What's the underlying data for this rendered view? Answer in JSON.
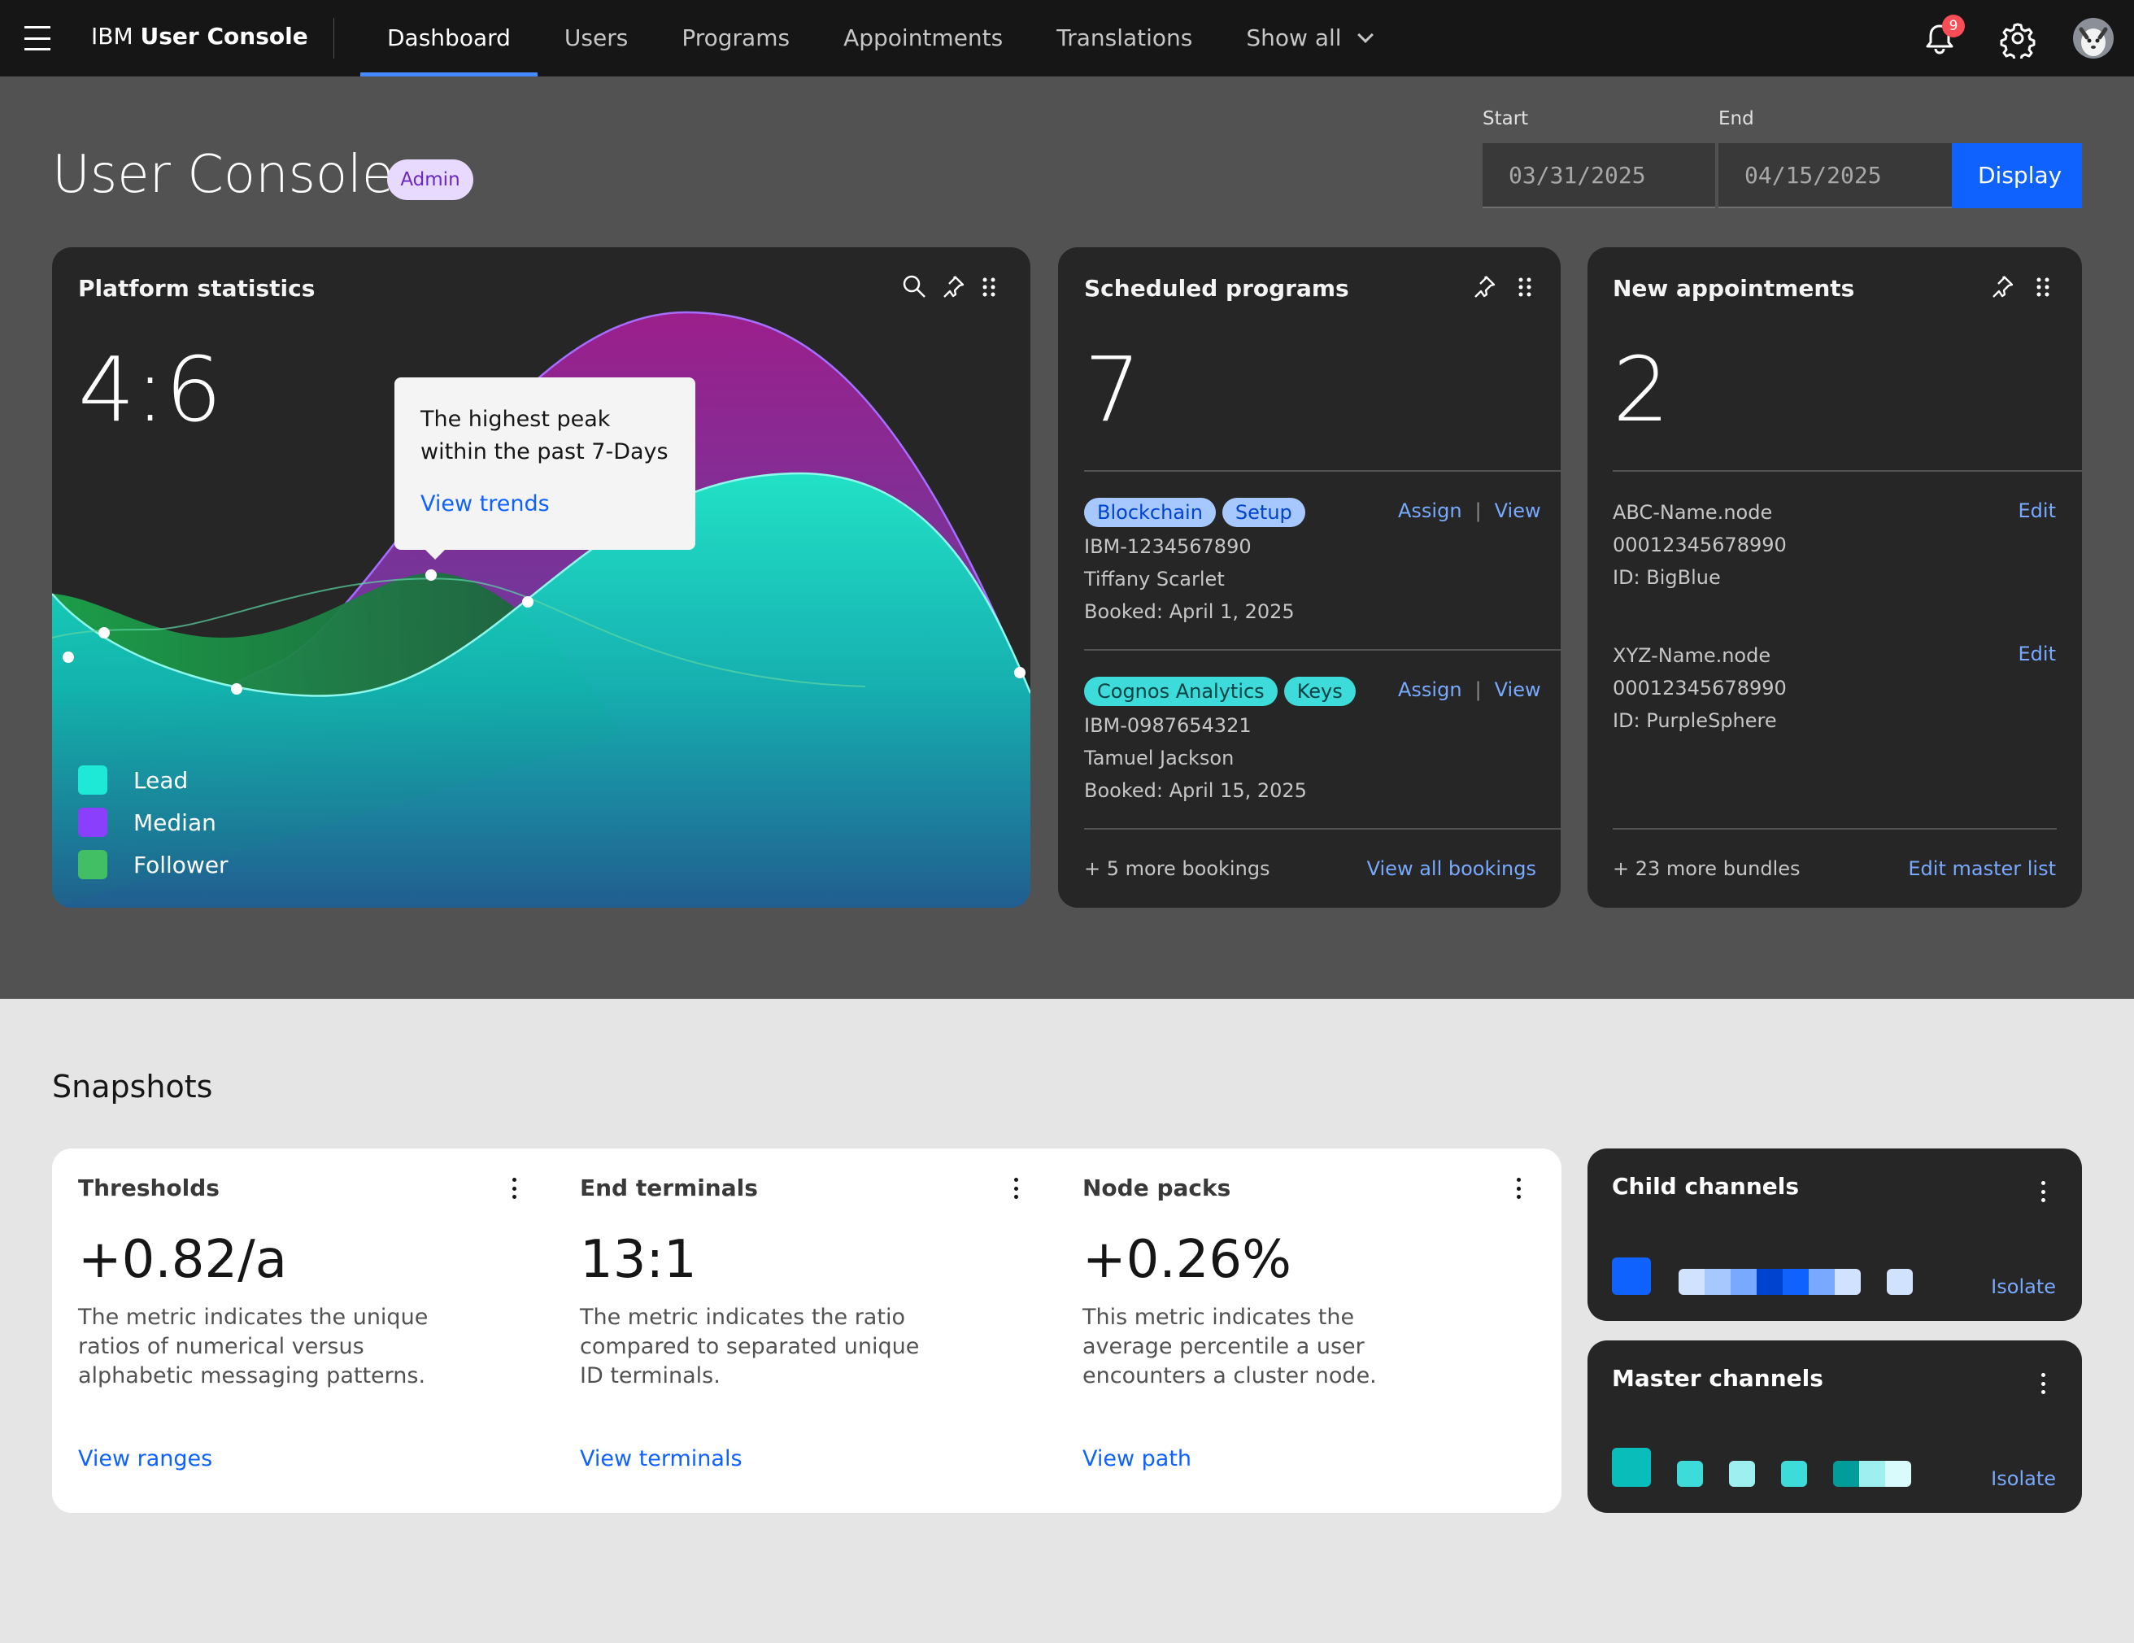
{
  "header": {
    "brand_prefix": "IBM",
    "brand_name": "User Console",
    "nav": [
      {
        "label": "Dashboard",
        "active": true
      },
      {
        "label": "Users"
      },
      {
        "label": "Programs"
      },
      {
        "label": "Appointments"
      },
      {
        "label": "Translations"
      },
      {
        "label": "Show all"
      }
    ],
    "notification_count": "9",
    "icons": [
      "menu-icon",
      "bell-icon",
      "gear-icon",
      "avatar"
    ]
  },
  "page": {
    "title": "User Console",
    "role_badge": "Admin",
    "start_label": "Start",
    "start_value": "03/31/2025",
    "end_label": "End",
    "end_value": "04/15/2025",
    "display_button": "Display"
  },
  "platform_stats": {
    "title": "Platform statistics",
    "ratio": "4:6",
    "tooltip_text": "The highest peak within the past 7-Days",
    "tooltip_link": "View trends",
    "legend": [
      {
        "name": "Lead",
        "color": "#1de9d6"
      },
      {
        "name": "Median",
        "color": "#8a3ffc"
      },
      {
        "name": "Follower",
        "color": "#42be65"
      }
    ]
  },
  "scheduled": {
    "title": "Scheduled programs",
    "count": "7",
    "items": [
      {
        "tags": [
          "Blockchain",
          "Setup"
        ],
        "id": "IBM-1234567890",
        "name": "Tiffany Scarlet",
        "booked": "Booked: April 1, 2025",
        "assign": "Assign",
        "view": "View"
      },
      {
        "tags": [
          "Cognos Analytics",
          "Keys"
        ],
        "id": "IBM-0987654321",
        "name": "Tamuel Jackson",
        "booked": "Booked: April 15, 2025",
        "assign": "Assign",
        "view": "View"
      }
    ],
    "more": "+ 5 more bookings",
    "view_all": "View all bookings"
  },
  "appointments": {
    "title": "New appointments",
    "count": "2",
    "items": [
      {
        "name": "ABC-Name.node",
        "number": "00012345678990",
        "id": "ID: BigBlue",
        "edit": "Edit"
      },
      {
        "name": "XYZ-Name.node",
        "number": "00012345678990",
        "id": "ID: PurpleSphere",
        "edit": "Edit"
      }
    ],
    "more": "+ 23 more bundles",
    "edit_master": "Edit master list"
  },
  "snapshots": {
    "title": "Snapshots",
    "cards": [
      {
        "title": "Thresholds",
        "value": "+0.82/a",
        "desc": "The metric indicates the unique ratios of numerical versus alphabetic messaging patterns.",
        "link": "View ranges"
      },
      {
        "title": "End terminals",
        "value": "13:1",
        "desc": "The metric indicates the ratio compared to separated unique ID terminals.",
        "link": "View terminals"
      },
      {
        "title": "Node packs",
        "value": "+0.26%",
        "desc": "This metric indicates the average percentile a user encounters a cluster node.",
        "link": "View path"
      }
    ]
  },
  "channels": {
    "child_title": "Child channels",
    "master_title": "Master channels",
    "isolate": "Isolate",
    "child_colors": [
      "#0f62fe",
      "#d0e2ff",
      "#a6c8ff",
      "#78a9ff",
      "#0043ce",
      "#0f62fe",
      "#78a9ff",
      "#d0e2ff"
    ],
    "master_colors": [
      "#08bdba",
      "#3ddbd9",
      "#9ef0f0",
      "#3ddbd9",
      "#009d9a",
      "#9ef0f0"
    ]
  }
}
